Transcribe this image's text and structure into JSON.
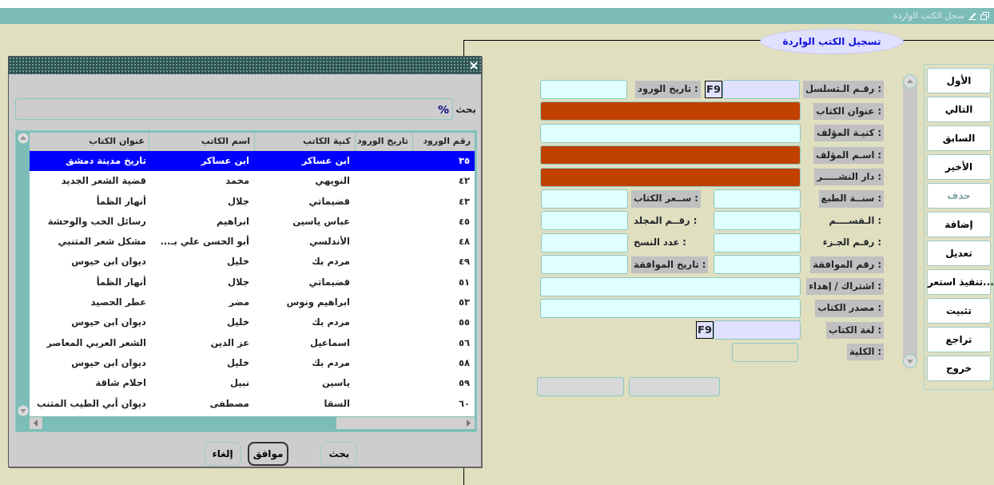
{
  "window": {
    "title": "سجل الكتب الواردة"
  },
  "form": {
    "legend": "تسجيل الكتب الواردة",
    "rows": [
      {
        "kind": "seq",
        "label": "رقـم الـتسلسل :",
        "shaded": true,
        "field": {
          "kind": "lov"
        },
        "f9": "F9",
        "label2": "تاريخ الورود :",
        "shaded2": true,
        "field2": {
          "kind": "plain"
        }
      },
      {
        "kind": "wide",
        "label": "عنوان الكتاب :",
        "shaded": true,
        "field": {
          "kind": "required"
        }
      },
      {
        "kind": "wide",
        "label": "كنيـة المؤلف :",
        "shaded": true,
        "field": {
          "kind": "plain"
        }
      },
      {
        "kind": "wide",
        "label": "اسـم المؤلف :",
        "shaded": true,
        "field": {
          "kind": "required"
        }
      },
      {
        "kind": "wide",
        "label": "دار النشـــــر :",
        "shaded": true,
        "field": {
          "kind": "required"
        }
      },
      {
        "kind": "pair",
        "label": "سنــة الطبع :",
        "shaded": true,
        "field": {
          "kind": "plain"
        },
        "label2": "ســعر الكتاب :",
        "shaded2": true,
        "field2": {
          "kind": "plain"
        }
      },
      {
        "kind": "pair",
        "label": "الـقســــم   :",
        "shaded": false,
        "field": {
          "kind": "plain"
        },
        "label2": "رقــم المجلد :",
        "shaded2": false,
        "field2": {
          "kind": "plain"
        }
      },
      {
        "kind": "pair",
        "label": "رقـم الجـزء :",
        "shaded": false,
        "field": {
          "kind": "plain"
        },
        "label2": "عدد النسخ :",
        "shaded2": false,
        "field2": {
          "kind": "plain"
        }
      },
      {
        "kind": "pair",
        "label": "رقم الموافقة :",
        "shaded": true,
        "field": {
          "kind": "plain"
        },
        "label2": "تاريخ الموافقة :",
        "shaded2": true,
        "field2": {
          "kind": "plain"
        }
      },
      {
        "kind": "wide",
        "label": "اشتراك / إهداء :",
        "shaded": true,
        "field": {
          "kind": "plain"
        }
      },
      {
        "kind": "wide",
        "label": "مصدر الكتاب :",
        "shaded": true,
        "field": {
          "kind": "plain"
        }
      },
      {
        "kind": "lang",
        "label": "لغة الكتاب :",
        "shaded": true,
        "field": {
          "kind": "lov"
        },
        "f9": "F9"
      },
      {
        "kind": "small",
        "label": "الكلية :",
        "shaded": true,
        "field": {
          "kind": "hollow"
        }
      }
    ],
    "bottom_fields": [
      {
        "disabled": true
      },
      {
        "disabled": true
      }
    ]
  },
  "buttons": [
    {
      "label": "الأول",
      "disabled": false
    },
    {
      "label": "التالي",
      "disabled": false
    },
    {
      "label": "السابق",
      "disabled": false
    },
    {
      "label": "الأخير",
      "disabled": false
    },
    {
      "label": "حذف",
      "disabled": true
    },
    {
      "label": "إضافة",
      "disabled": false
    },
    {
      "label": "تعديل",
      "disabled": false
    },
    {
      "label": "تنفيذ استعر...",
      "disabled": false
    },
    {
      "label": "تثبيت",
      "disabled": false
    },
    {
      "label": "تراجع",
      "disabled": false
    },
    {
      "label": "خروج",
      "disabled": false
    }
  ],
  "dialog": {
    "search_label": "بحث",
    "search_value": "%",
    "columns": [
      "رقم الورود",
      "تاريخ الورود",
      "كنية الكاتب",
      "اسم الكاتب",
      "عنوان الكتاب"
    ],
    "rows": [
      {
        "number": "٣٥",
        "surname": "ابن عساكر",
        "name": "ابن عساكر",
        "title": "تاريخ مدينة دمشق",
        "selected": true
      },
      {
        "number": "٤٢",
        "surname": "النويهي",
        "name": "محمد",
        "title": "قضية الشعر الجديد",
        "selected": false
      },
      {
        "number": "٤٣",
        "surname": "قضيماتي",
        "name": "جلال",
        "title": "أنهار الظمأ",
        "selected": false
      },
      {
        "number": "٤٥",
        "surname": "عباس ياسين",
        "name": "ابراهيم",
        "title": "رسائل الحب والوحشة",
        "selected": false
      },
      {
        "number": "٤٨",
        "surname": "الأندلسي",
        "name": "أبو الحسن علي بـ...",
        "title": "مشكل شعر المتنبي",
        "selected": false
      },
      {
        "number": "٤٩",
        "surname": "مردم بك",
        "name": "خليل",
        "title": "ديوان ابن حيوس",
        "selected": false
      },
      {
        "number": "٥١",
        "surname": "قضيماتي",
        "name": "جلال",
        "title": "أنهار الظمأ",
        "selected": false
      },
      {
        "number": "٥٣",
        "surname": "ابراهيم ونوس",
        "name": "مضر",
        "title": "عطر الحصيد",
        "selected": false
      },
      {
        "number": "٥٥",
        "surname": "مردم بك",
        "name": "خليل",
        "title": "ديوان ابن حيوس",
        "selected": false
      },
      {
        "number": "٥٦",
        "surname": "اسماعيل",
        "name": "عز الدين",
        "title": "الشعر العربي المعاصر",
        "selected": false
      },
      {
        "number": "٥٨",
        "surname": "مردم بك",
        "name": "خليل",
        "title": "ديوان ابن حيوس",
        "selected": false
      },
      {
        "number": "٥٩",
        "surname": "ياسين",
        "name": "نبيل",
        "title": "احلام شاقة",
        "selected": false
      },
      {
        "number": "٦٠",
        "surname": "السقا",
        "name": "مصطفى",
        "title": "ديوان أبي الطيب المتنب",
        "selected": false
      }
    ],
    "buttons": [
      {
        "label": "بحث",
        "default": false
      },
      {
        "label": "موافق",
        "default": true
      },
      {
        "label": "إلغاء",
        "default": false
      }
    ]
  }
}
